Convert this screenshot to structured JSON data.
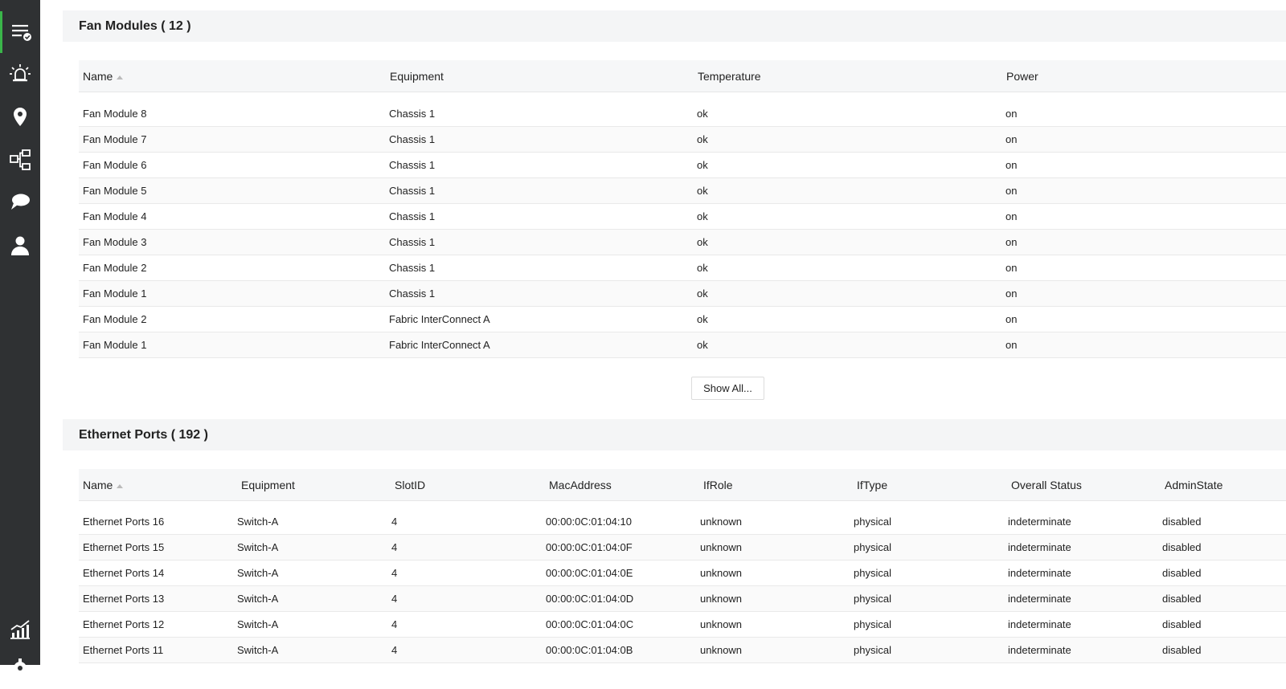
{
  "sidebar": {
    "items": [
      {
        "icon": "checklist-icon",
        "active": true
      },
      {
        "icon": "alarm-icon",
        "active": false
      },
      {
        "icon": "location-pin-icon",
        "active": false
      },
      {
        "icon": "network-map-icon",
        "active": false
      },
      {
        "icon": "chat-icon",
        "active": false
      },
      {
        "icon": "user-icon",
        "active": false
      },
      {
        "icon": "chart-trend-icon",
        "active": false
      },
      {
        "icon": "gear-icon",
        "active": false
      }
    ],
    "accent_color": "#3ab54a",
    "background": "#2f3133"
  },
  "fan_modules": {
    "title": "Fan Modules ( 12 )",
    "columns": [
      "Name",
      "Equipment",
      "Temperature",
      "Power"
    ],
    "rows": [
      [
        "Fan Module 8",
        "Chassis 1",
        "ok",
        "on"
      ],
      [
        "Fan Module 7",
        "Chassis 1",
        "ok",
        "on"
      ],
      [
        "Fan Module 6",
        "Chassis 1",
        "ok",
        "on"
      ],
      [
        "Fan Module 5",
        "Chassis 1",
        "ok",
        "on"
      ],
      [
        "Fan Module 4",
        "Chassis 1",
        "ok",
        "on"
      ],
      [
        "Fan Module 3",
        "Chassis 1",
        "ok",
        "on"
      ],
      [
        "Fan Module 2",
        "Chassis 1",
        "ok",
        "on"
      ],
      [
        "Fan Module 1",
        "Chassis 1",
        "ok",
        "on"
      ],
      [
        "Fan Module 2",
        "Fabric InterConnect A",
        "ok",
        "on"
      ],
      [
        "Fan Module 1",
        "Fabric InterConnect A",
        "ok",
        "on"
      ]
    ],
    "show_all_label": "Show All..."
  },
  "ethernet_ports": {
    "title": "Ethernet Ports ( 192 )",
    "columns": [
      "Name",
      "Equipment",
      "SlotID",
      "MacAddress",
      "IfRole",
      "IfType",
      "Overall Status",
      "AdminState"
    ],
    "rows": [
      [
        "Ethernet Ports 16",
        "Switch-A",
        "4",
        "00:00:0C:01:04:10",
        "unknown",
        "physical",
        "indeterminate",
        "disabled"
      ],
      [
        "Ethernet Ports 15",
        "Switch-A",
        "4",
        "00:00:0C:01:04:0F",
        "unknown",
        "physical",
        "indeterminate",
        "disabled"
      ],
      [
        "Ethernet Ports 14",
        "Switch-A",
        "4",
        "00:00:0C:01:04:0E",
        "unknown",
        "physical",
        "indeterminate",
        "disabled"
      ],
      [
        "Ethernet Ports 13",
        "Switch-A",
        "4",
        "00:00:0C:01:04:0D",
        "unknown",
        "physical",
        "indeterminate",
        "disabled"
      ],
      [
        "Ethernet Ports 12",
        "Switch-A",
        "4",
        "00:00:0C:01:04:0C",
        "unknown",
        "physical",
        "indeterminate",
        "disabled"
      ],
      [
        "Ethernet Ports 11",
        "Switch-A",
        "4",
        "00:00:0C:01:04:0B",
        "unknown",
        "physical",
        "indeterminate",
        "disabled"
      ]
    ]
  }
}
